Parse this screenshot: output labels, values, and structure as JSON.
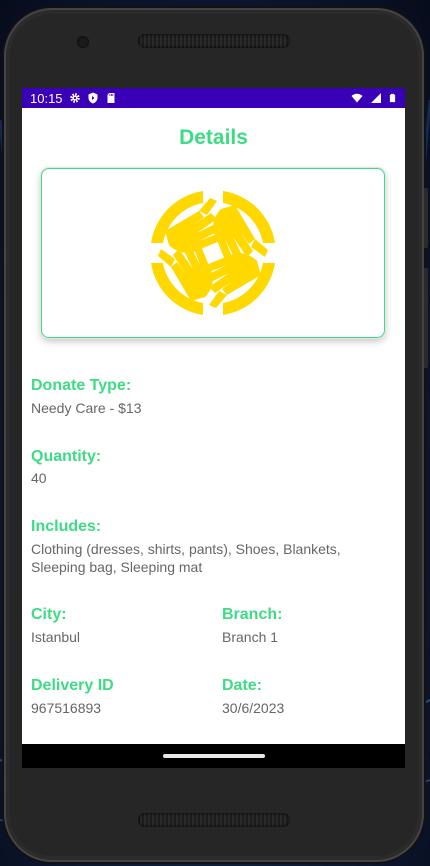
{
  "status_bar": {
    "time": "10:15",
    "left_icons": [
      "settings-icon",
      "play-protect-icon",
      "sd-card-icon"
    ],
    "right_icons": [
      "wifi-icon",
      "signal-icon",
      "battery-icon"
    ],
    "color": "#3a00b8"
  },
  "page": {
    "title": "Details",
    "accent_color": "#3ddc84",
    "logo_icon": "helping-hands-logo",
    "logo_color": "#ffd800"
  },
  "fields": {
    "donate_type": {
      "label": "Donate Type:",
      "value": "Needy Care - $13"
    },
    "quantity": {
      "label": "Quantity:",
      "value": "40"
    },
    "includes": {
      "label": "Includes:",
      "value_line1": "Clothing (dresses, shirts, pants), Shoes, Blankets,",
      "value_line2": "Sleeping bag, Sleeping mat"
    },
    "city": {
      "label": "City:",
      "value": "Istanbul"
    },
    "branch": {
      "label": "Branch:",
      "value": "Branch 1"
    },
    "delivery_id": {
      "label": "Delivery ID",
      "value": "967516893"
    },
    "date": {
      "label": "Date:",
      "value": "30/6/2023"
    }
  }
}
